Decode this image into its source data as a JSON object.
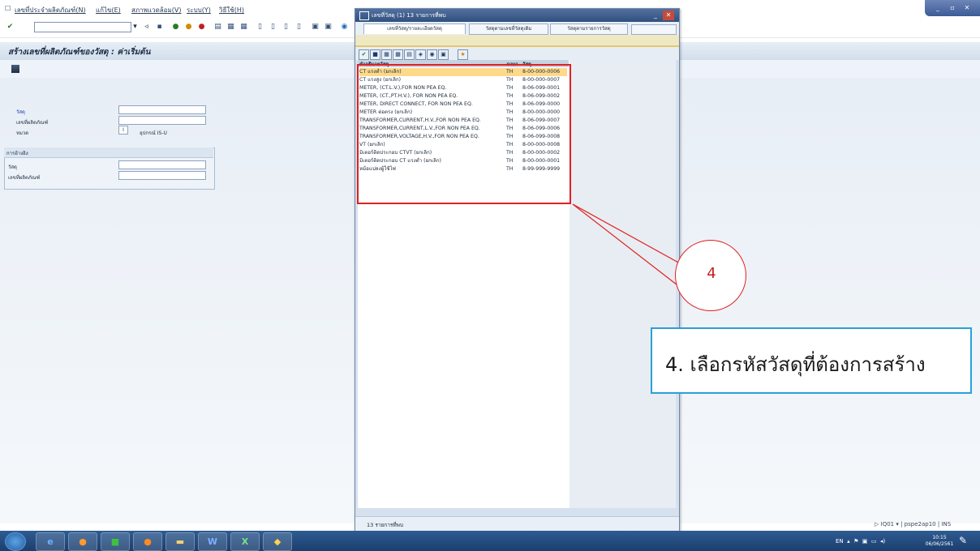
{
  "menu": {
    "item1": "เลขที่ประจำผลิตภัณฑ์(N)",
    "item2": "แก้ไข(E)",
    "item3": "สภาพแวดล้อม(V)",
    "item4": "ระบบ(Y)",
    "item5": "วิธีใช้(H)"
  },
  "page": {
    "title": "สร้างเลขที่ผลิตภัณฑ์ของวัสดุ : ค่าเริ่มต้น"
  },
  "form": {
    "material_label": "วัสดุ",
    "serial_label": "เลขที่ผลิตภัณฑ์",
    "category_label": "หมวด",
    "category_value": "I",
    "category_text": "อุปกรณ์ IS-U",
    "reference_title": "การอ้างอิง",
    "ref_material_label": "วัสดุ",
    "ref_serial_label": "เลขที่ผลิตภัณฑ์"
  },
  "status_bar": {
    "system": "IQ01",
    "server": "pspe2ap10",
    "mode": "INS"
  },
  "popup": {
    "title": "เลขที่วัสดุ (1)  13 รายการที่พบ",
    "tabs": [
      "เลขที่วัสดุ/รายละเอียดวัสดุ",
      "วัสดุตามเลขที่วัสดุเดิม",
      "วัสดุตามรายการวัสดุ"
    ],
    "col_desc": "คำอธิบายวัสดุ",
    "col_lang": "ภาษา",
    "col_mat": "วัสดุ",
    "rows": [
      {
        "desc": "CT แรงต่ำ (ยกเลิก)",
        "lang": "TH",
        "mat": "8-00-000-0006"
      },
      {
        "desc": "CT แรงสูง (ยกเลิก)",
        "lang": "TH",
        "mat": "8-00-000-0007"
      },
      {
        "desc": "METER, (CT.L.V.),FOR NON PEA EQ.",
        "lang": "TH",
        "mat": "8-06-099-0001"
      },
      {
        "desc": "METER, (CT.,PT.H.V.), FOR NON PEA EQ.",
        "lang": "TH",
        "mat": "8-06-099-0002"
      },
      {
        "desc": "METER, DIRECT CONNECT, FOR NON PEA EQ.",
        "lang": "TH",
        "mat": "8-06-099-0000"
      },
      {
        "desc": "METER ต่อตรง (ยกเลิก)",
        "lang": "TH",
        "mat": "8-00-000-0000"
      },
      {
        "desc": "TRANSFORMER,CURRENT,H.V.,FOR NON PEA EQ.",
        "lang": "TH",
        "mat": "8-06-099-0007"
      },
      {
        "desc": "TRANSFORMER,CURRENT,L.V.,FOR NON PEA EQ.",
        "lang": "TH",
        "mat": "8-06-099-0006"
      },
      {
        "desc": "TRANSFORMER,VOLTAGE,H.V.,FOR NON PEA EQ.",
        "lang": "TH",
        "mat": "8-06-099-0008"
      },
      {
        "desc": "VT (ยกเลิก)",
        "lang": "TH",
        "mat": "8-00-000-0008"
      },
      {
        "desc": "มิเตอร์ติดประกอบ CTVT (ยกเลิก)",
        "lang": "TH",
        "mat": "8-00-000-0002"
      },
      {
        "desc": "มิเตอร์ติดประกอบ CT แรงต่ำ (ยกเลิก)",
        "lang": "TH",
        "mat": "8-00-000-0001"
      },
      {
        "desc": "หม้อแปลงผู้ใช้ไฟ",
        "lang": "TH",
        "mat": "8-99-999-9999"
      }
    ],
    "status": "13 รายการที่พบ"
  },
  "annotation": {
    "number": "4",
    "note": "4. เลือกรหัสวัสดุที่ต้องการสร้าง"
  },
  "taskbar": {
    "lang": "EN",
    "time": "10:15",
    "date": "06/06/2561"
  },
  "colors": {
    "accent_red": "#e02020",
    "note_border": "#2aa0d8",
    "selected_row": "#ffd98a"
  }
}
